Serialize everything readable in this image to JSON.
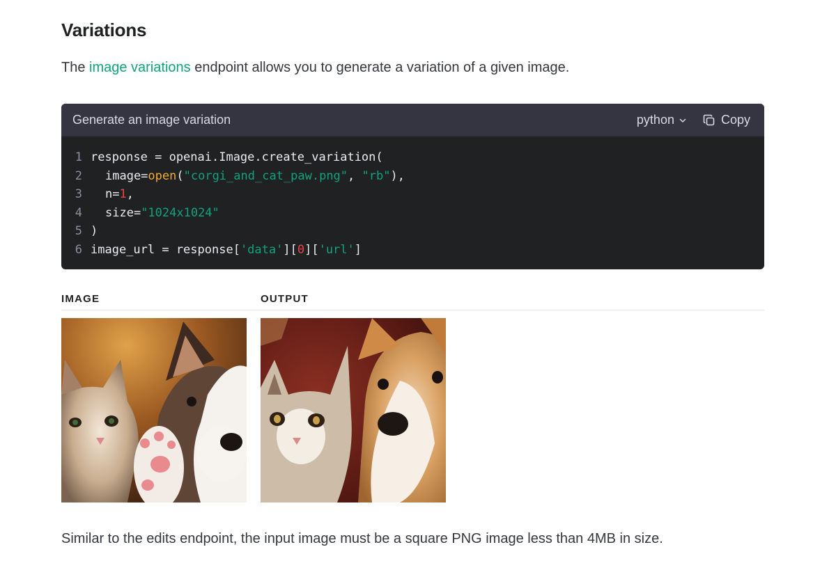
{
  "section": {
    "heading": "Variations"
  },
  "intro": {
    "prefix": "The ",
    "link_text": "image variations",
    "suffix": " endpoint allows you to generate a variation of a given image."
  },
  "code_block": {
    "title": "Generate an image variation",
    "language": "python",
    "copy_label": "Copy",
    "line_numbers": [
      "1",
      "2",
      "3",
      "4",
      "5",
      "6"
    ],
    "lines": [
      "response = openai.Image.create_variation(",
      "  image=open(\"corgi_and_cat_paw.png\", \"rb\"),",
      "  n=1,",
      "  size=\"1024x1024\"",
      ")",
      "image_url = response['data'][0]['url']"
    ],
    "tokens": {
      "l1": {
        "a": "response = openai.Image.create_variation("
      },
      "l2": {
        "a": "image=",
        "fn": "open",
        "b": "(",
        "s1": "\"corgi_and_cat_paw.png\"",
        "c": ", ",
        "s2": "\"rb\"",
        "d": "),"
      },
      "l3": {
        "a": "n=",
        "num": "1",
        "b": ","
      },
      "l4": {
        "a": "size=",
        "s": "\"1024x1024\""
      },
      "l5": {
        "a": ")"
      },
      "l6": {
        "a": "image_url = response[",
        "s1": "'data'",
        "b": "][",
        "num": "0",
        "c": "][",
        "s2": "'url'",
        "d": "]"
      }
    }
  },
  "examples": {
    "image_label": "IMAGE",
    "output_label": "OUTPUT"
  },
  "footer": {
    "text": "Similar to the edits endpoint, the input image must be a square PNG image less than 4MB in size."
  },
  "colors": {
    "accent": "#10a37f",
    "code_bg": "#202123",
    "code_header_bg": "#343541",
    "string": "#10a37f",
    "number": "#ef4146",
    "function": "#f4ac36"
  },
  "icons": {
    "chevron": "chevron-down-icon",
    "copy": "copy-icon"
  }
}
